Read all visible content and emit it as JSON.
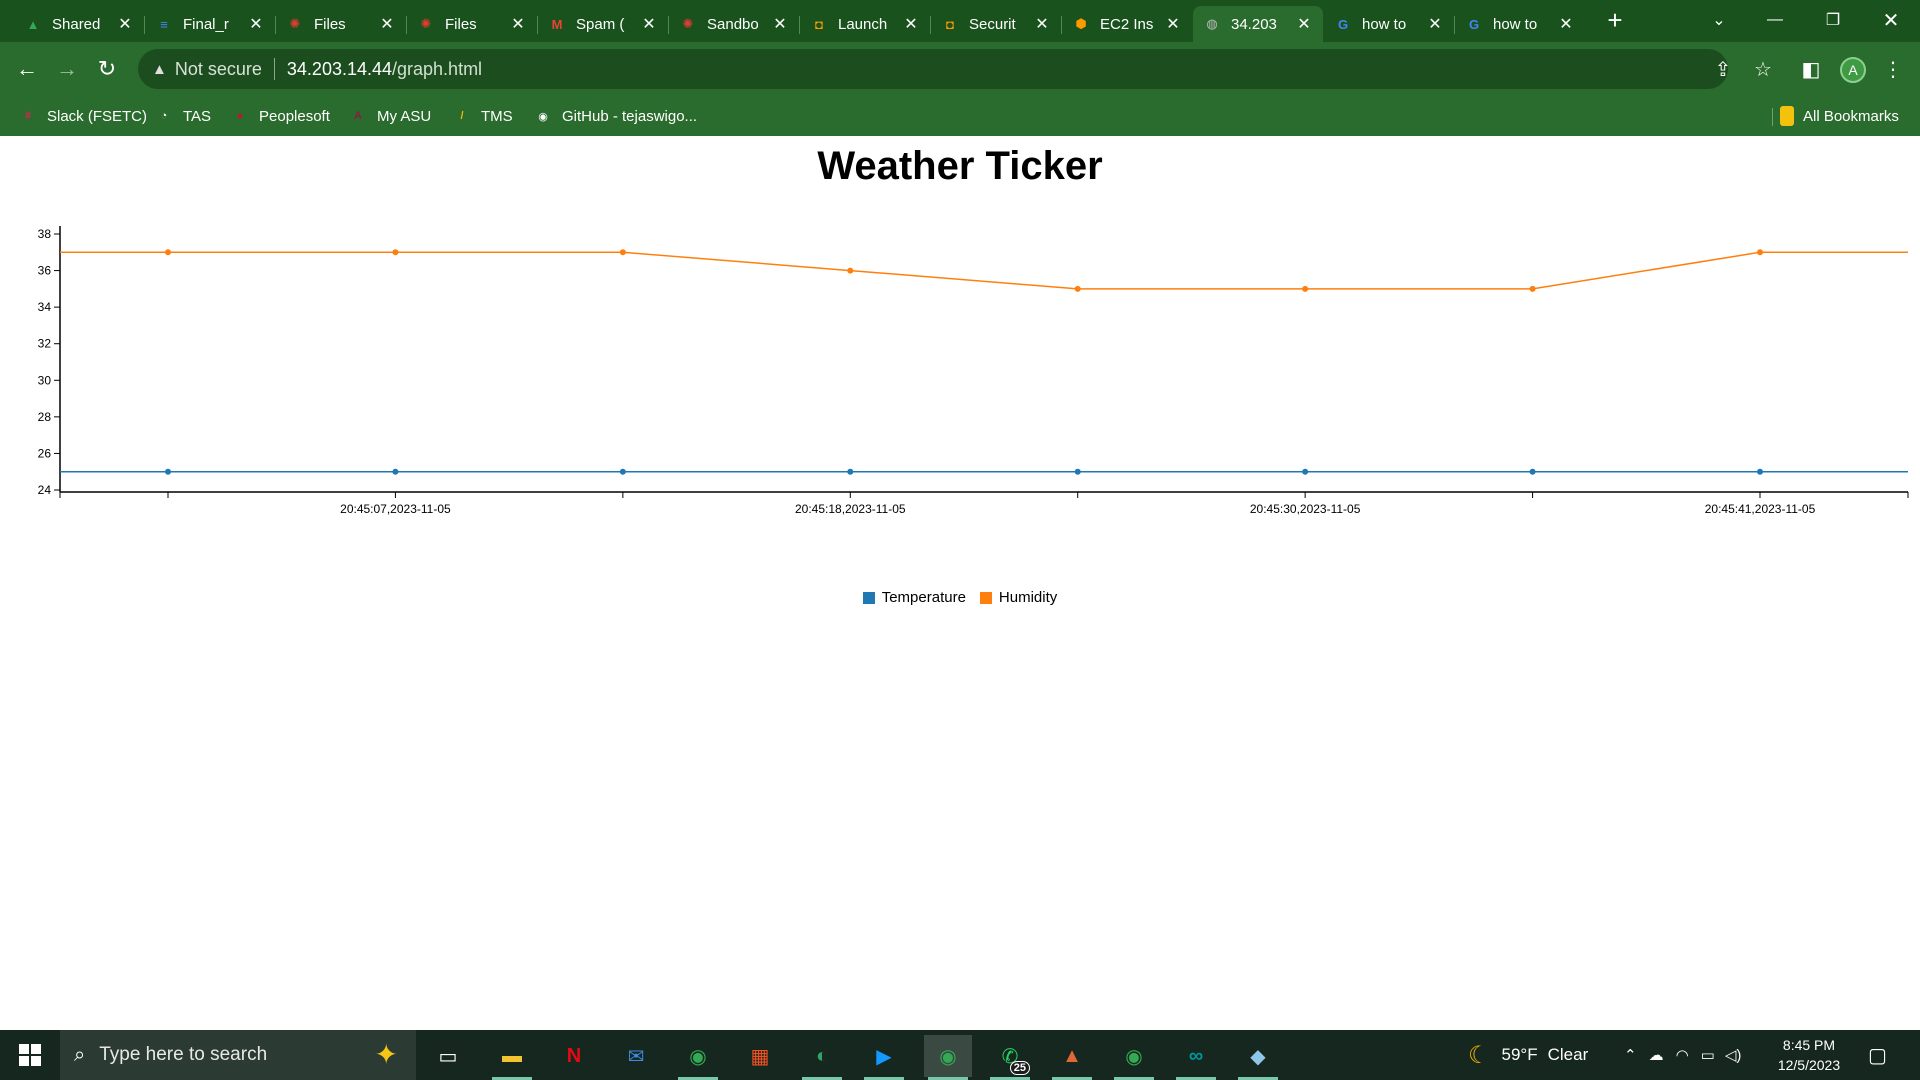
{
  "browser": {
    "tabs": [
      {
        "label": "Shared",
        "icon": "google-drive-icon",
        "color": "#34a853"
      },
      {
        "label": "Final_r",
        "icon": "google-docs-icon",
        "color": "#4285f4"
      },
      {
        "label": "Files",
        "icon": "canvas-icon",
        "color": "#e03c31"
      },
      {
        "label": "Files",
        "icon": "canvas-icon",
        "color": "#e03c31"
      },
      {
        "label": "Spam (",
        "icon": "gmail-icon",
        "color": "#ea4335"
      },
      {
        "label": "Sandbo",
        "icon": "canvas-icon",
        "color": "#e03c31"
      },
      {
        "label": "Launch",
        "icon": "aws-icon",
        "color": "#ff9900"
      },
      {
        "label": "Securit",
        "icon": "aws-icon",
        "color": "#ff9900"
      },
      {
        "label": "EC2 Ins",
        "icon": "ec2-icon",
        "color": "#ff9900"
      },
      {
        "label": "34.203",
        "icon": "globe-icon",
        "color": "#bbbbbb"
      },
      {
        "label": "how to",
        "icon": "google-icon",
        "color": "#4285f4"
      },
      {
        "label": "how to",
        "icon": "google-icon",
        "color": "#4285f4"
      }
    ],
    "active_tab": 9,
    "security_label": "Not secure",
    "url_host": "34.203.14.44",
    "url_path": "/graph.html",
    "profile_initial": "A",
    "bookmarks": [
      {
        "label": "Slack (FSETC)",
        "icon": "slack-icon"
      },
      {
        "label": "TAS",
        "icon": "clock-icon"
      },
      {
        "label": "Peoplesoft",
        "icon": "peoplesoft-icon"
      },
      {
        "label": "My ASU",
        "icon": "asu-icon"
      },
      {
        "label": "TMS",
        "icon": "tms-icon"
      },
      {
        "label": "GitHub - tejaswigo...",
        "icon": "github-icon"
      }
    ],
    "all_bookmarks_label": "All Bookmarks"
  },
  "page": {
    "title": "Weather Ticker"
  },
  "chart_data": {
    "type": "line",
    "title": "Weather Ticker",
    "xlabel": "",
    "ylabel": "",
    "ylim": [
      24,
      38
    ],
    "yticks": [
      24,
      26,
      28,
      30,
      32,
      34,
      36,
      38
    ],
    "x_tick_labels": [
      "20:45:07,2023-11-05",
      "20:45:18,2023-11-05",
      "20:45:30,2023-11-05",
      "20:45:41,2023-11-05"
    ],
    "x_tick_label_indices": [
      1,
      3,
      5,
      7
    ],
    "point_count": 8,
    "series": [
      {
        "name": "Temperature",
        "color": "#1f77b4",
        "values": [
          25,
          25,
          25,
          25,
          25,
          25,
          25,
          25
        ]
      },
      {
        "name": "Humidity",
        "color": "#ff7f0e",
        "values": [
          37,
          37,
          37,
          36,
          35,
          35,
          35,
          37
        ]
      }
    ],
    "legend_position": "bottom-center",
    "grid": false
  },
  "taskbar": {
    "search_placeholder": "Type here to search",
    "apps": [
      {
        "name": "task-view-icon",
        "glyph": "▭"
      },
      {
        "name": "file-explorer-icon",
        "glyph": "▬"
      },
      {
        "name": "netflix-icon",
        "glyph": "N"
      },
      {
        "name": "mail-icon",
        "glyph": "✉"
      },
      {
        "name": "chrome-icon",
        "glyph": "◉"
      },
      {
        "name": "store-icon",
        "glyph": "▦"
      },
      {
        "name": "edge-icon",
        "glyph": "◐"
      },
      {
        "name": "prime-video-icon",
        "glyph": "▶"
      },
      {
        "name": "chrome-icon",
        "glyph": "◉"
      },
      {
        "name": "whatsapp-icon",
        "glyph": "✆"
      },
      {
        "name": "matlab-icon",
        "glyph": "▲"
      },
      {
        "name": "chrome-icon",
        "glyph": "◉"
      },
      {
        "name": "arduino-icon",
        "glyph": "∞"
      },
      {
        "name": "notes-icon",
        "glyph": "◆"
      }
    ],
    "whatsapp_badge": "25",
    "weather_temp": "59°F",
    "weather_cond": "Clear",
    "time": "8:45 PM",
    "date": "12/5/2023"
  }
}
